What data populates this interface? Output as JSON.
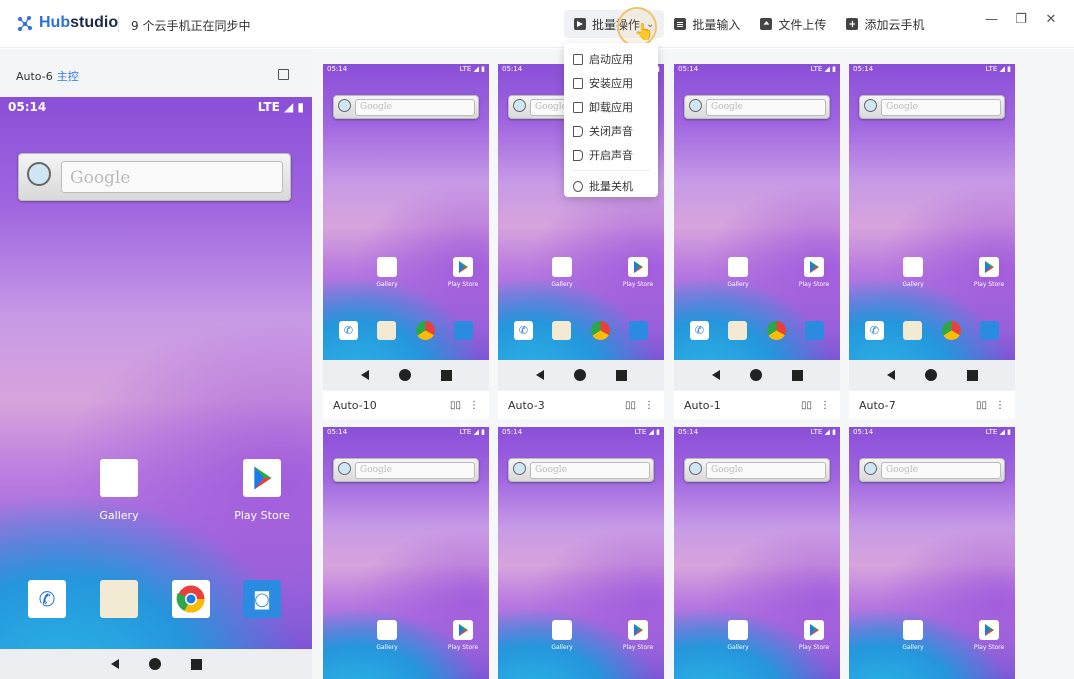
{
  "app": {
    "brand_hub": "Hub",
    "brand_studio": "studio",
    "sync_status": "9 个云手机正在同步中"
  },
  "toolbar": {
    "batch_ops": "批量操作",
    "batch_input": "批量输入",
    "file_upload": "文件上传",
    "add_cloud_phone": "添加云手机"
  },
  "dropdown": {
    "items": [
      "启动应用",
      "安装应用",
      "卸载应用",
      "关闭声音",
      "开启声音"
    ],
    "shutdown": "批量关机"
  },
  "main_phone": {
    "name": "Auto-6",
    "role": "主控"
  },
  "phone_ui": {
    "time": "05:14",
    "signal": "LTE",
    "search_text": "Google",
    "gallery": "Gallery",
    "play_store": "Play Store"
  },
  "devices": [
    {
      "name": "Auto-10"
    },
    {
      "name": "Auto-3"
    },
    {
      "name": "Auto-1"
    },
    {
      "name": "Auto-7"
    }
  ],
  "colors": {
    "accent": "#2f7ae5",
    "brand": "#2f6fe0",
    "highlight_ring": "#f1c46a"
  }
}
